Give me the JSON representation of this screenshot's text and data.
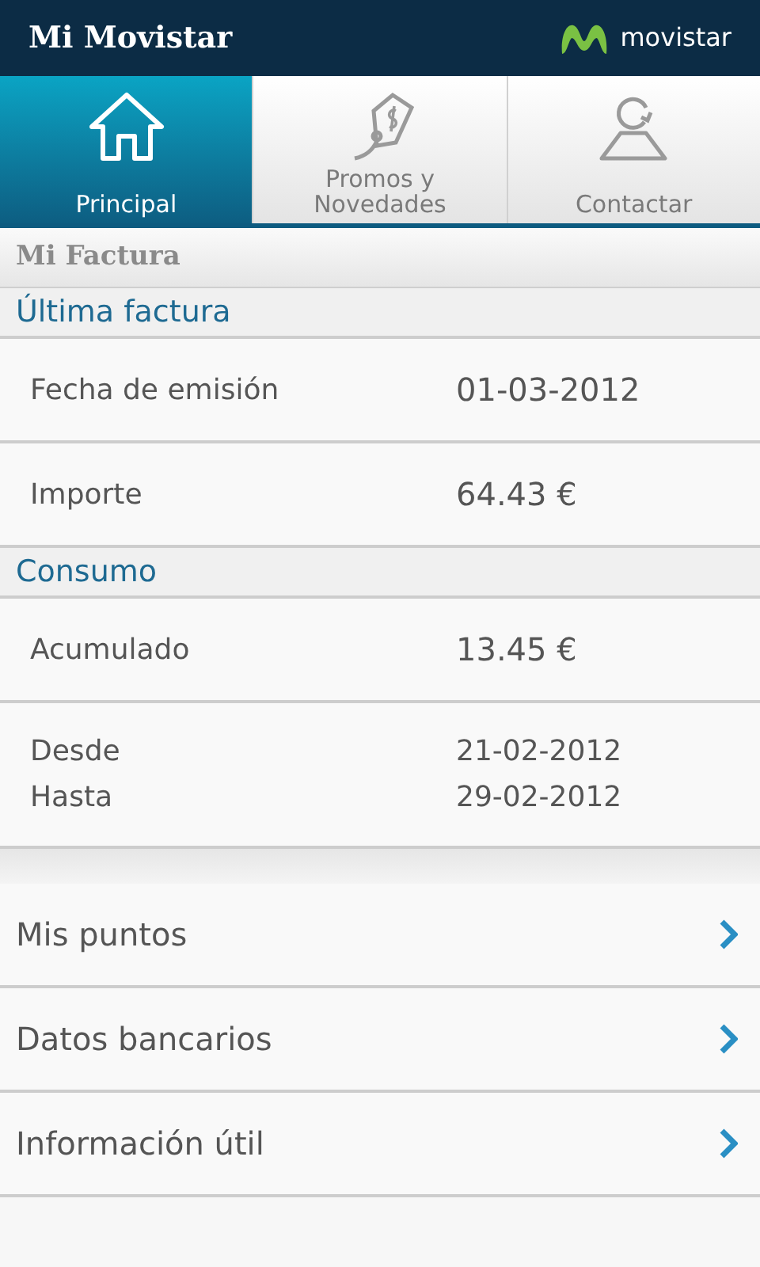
{
  "header": {
    "title": "Mi Movistar",
    "brand": "movistar"
  },
  "tabs": [
    {
      "label": "Principal",
      "kind": "home",
      "selected": true
    },
    {
      "label": "Promos y Novedades",
      "kind": "tag",
      "selected": false
    },
    {
      "label": "Contactar",
      "kind": "person",
      "selected": false
    }
  ],
  "page_title": "Mi Factura",
  "sections": [
    {
      "title": "Última factura",
      "rows": [
        {
          "lines": [
            {
              "label": "Fecha de emisión",
              "value": "01-03-2012"
            }
          ]
        },
        {
          "lines": [
            {
              "label": "Importe",
              "value": "64.43 €"
            }
          ]
        }
      ]
    },
    {
      "title": "Consumo",
      "rows": [
        {
          "lines": [
            {
              "label": "Acumulado",
              "value": "13.45 €"
            }
          ]
        },
        {
          "lines": [
            {
              "label": "Desde",
              "value": "21-02-2012"
            },
            {
              "label": "Hasta",
              "value": "29-02-2012"
            }
          ]
        }
      ]
    }
  ],
  "links": [
    {
      "label": "Mis puntos"
    },
    {
      "label": "Datos bancarios"
    },
    {
      "label": "Información útil"
    }
  ]
}
